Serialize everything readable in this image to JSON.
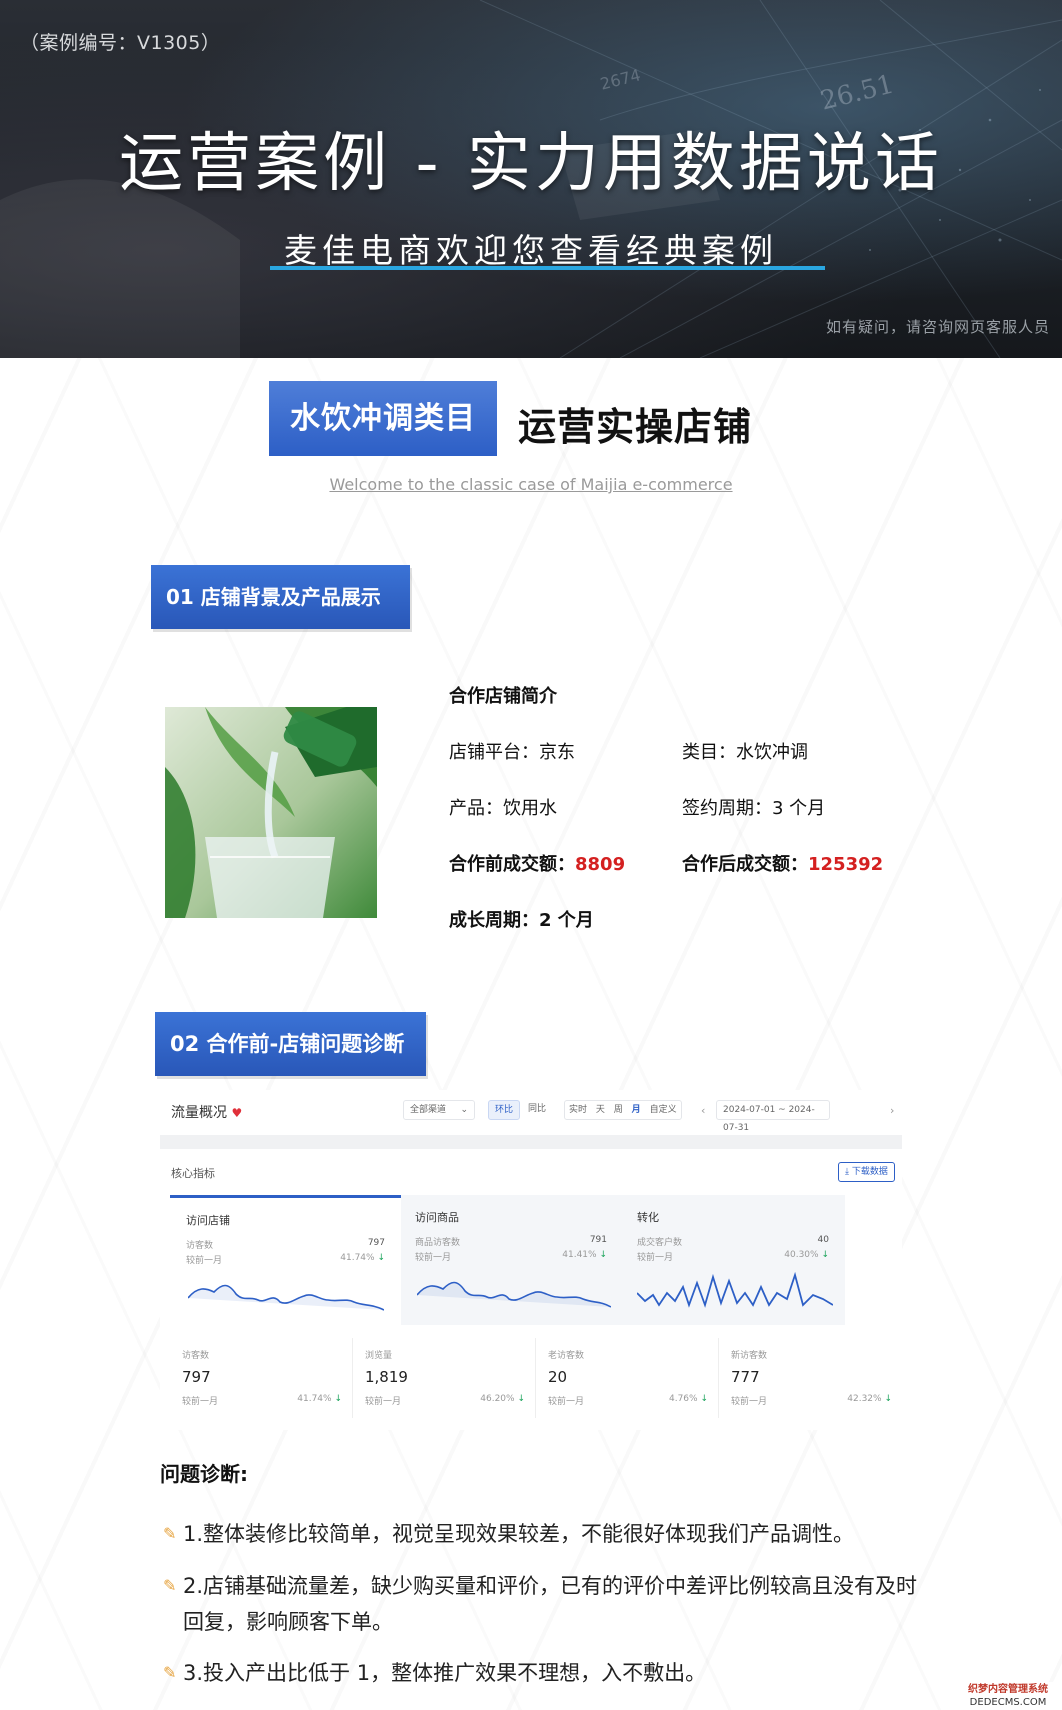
{
  "banner": {
    "case_no": "（案例编号：V1305）",
    "title": "运营案例 - 实力用数据说话",
    "subtitle": "麦佳电商欢迎您查看经典案例",
    "note": "如有疑问，请咨询网页客服人员",
    "fig_a": "26.51",
    "fig_b": "2674"
  },
  "heading": {
    "category": "水饮冲调类目",
    "title": "运营实操店铺",
    "welcome": "Welcome to the classic case of Maijia e-commerce"
  },
  "section1": {
    "title": "01 店铺背景及产品展示"
  },
  "store": {
    "title": "合作店铺简介",
    "platform": "店铺平台：京东",
    "category": "类目：水饮冲调",
    "product": "产品：饮用水",
    "period": "签约周期：3 个月",
    "before_label": "合作前成交额：",
    "before_value": "8809",
    "after_label": "合作后成交额：",
    "after_value": "125392",
    "growth": "成长周期：2 个月"
  },
  "section2": {
    "title": "02 合作前-店铺问题诊断"
  },
  "dashboard": {
    "title": "流量概况",
    "channel": "全部渠道",
    "btn_hb": "环比",
    "btn_tb": "同比",
    "tabs": [
      "实时",
      "天",
      "周",
      "月",
      "自定义"
    ],
    "date_range": "2024-07-01 ~ 2024-07-31",
    "core": "核心指标",
    "download": "下载数据",
    "cards": [
      {
        "title": "访问店铺",
        "metric": "访客数",
        "value": "797",
        "compare": "较前一月",
        "pct": "41.74%"
      },
      {
        "title": "访问商品",
        "metric": "商品访客数",
        "value": "791",
        "compare": "较前一月",
        "pct": "41.41%"
      },
      {
        "title": "转化",
        "metric": "成交客户数",
        "value": "40",
        "compare": "较前一月",
        "pct": "40.30%"
      }
    ],
    "kpis": [
      {
        "label": "访客数",
        "value": "797",
        "compare": "较前一月",
        "pct": "41.74%"
      },
      {
        "label": "浏览量",
        "value": "1,819",
        "compare": "较前一月",
        "pct": "46.20%"
      },
      {
        "label": "老访客数",
        "value": "20",
        "compare": "较前一月",
        "pct": "4.76%"
      },
      {
        "label": "新访客数",
        "value": "777",
        "compare": "较前一月",
        "pct": "42.32%"
      }
    ]
  },
  "diagnosis": {
    "title": "问题诊断:",
    "items": [
      "1.整体装修比较简单，视觉呈现效果较差，不能很好体现我们产品调性。",
      "2.店铺基础流量差，缺少购买量和评价，已有的评价中差评比例较高且没有及时回复，影响顾客下单。",
      "3.投入产出比低于 1，整体推广效果不理想，入不敷出。"
    ]
  },
  "watermark": {
    "line1": "织梦内容管理系统",
    "line2": "DEDECMS.COM"
  },
  "colors": {
    "accent": "#2d5fc6",
    "highlight": "#d42020",
    "banner_line": "#2aa6e0"
  }
}
